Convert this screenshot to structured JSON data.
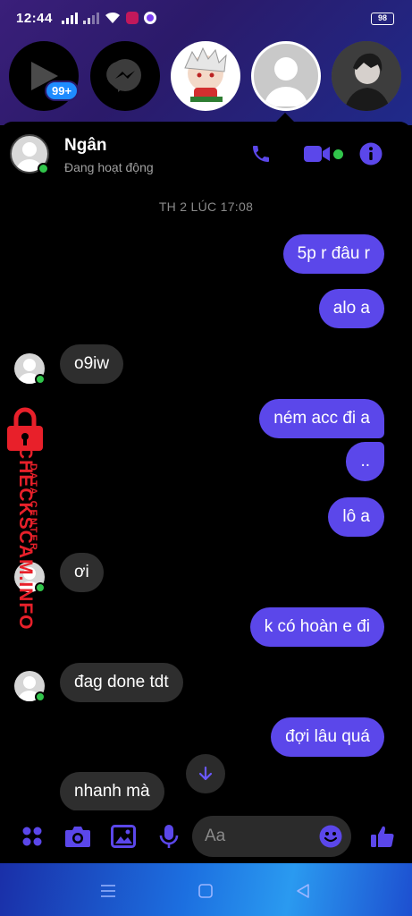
{
  "status_bar": {
    "time": "12:44",
    "battery": "98"
  },
  "chat_heads": {
    "unread_badge": "99+"
  },
  "header": {
    "name": "Ngân",
    "status": "Đang hoạt động"
  },
  "timestamp": "TH 2 LÚC 17:08",
  "messages": [
    {
      "from": "me",
      "text": "5p r đâu r"
    },
    {
      "from": "me",
      "text": "alo a"
    },
    {
      "from": "them",
      "text": "o9iw"
    },
    {
      "from": "me",
      "text": "ném acc đi a"
    },
    {
      "from": "me",
      "text": ".."
    },
    {
      "from": "me",
      "text": "lô a"
    },
    {
      "from": "them",
      "text": "ơi"
    },
    {
      "from": "me",
      "text": "k có hoàn e đi"
    },
    {
      "from": "them",
      "text": "đag done tdt"
    },
    {
      "from": "me",
      "text": "đợi lâu quá"
    },
    {
      "from": "them",
      "text": "nhanh mà"
    }
  ],
  "composer": {
    "placeholder": "Aa"
  },
  "watermark": {
    "brand": "CHECKSCAM.INFO",
    "tagline": "DATA CENTER"
  },
  "colors": {
    "accent": "#5b47ea",
    "incoming_bubble": "#2e2e2e",
    "online": "#31c54b",
    "watermark": "#e8202a"
  }
}
